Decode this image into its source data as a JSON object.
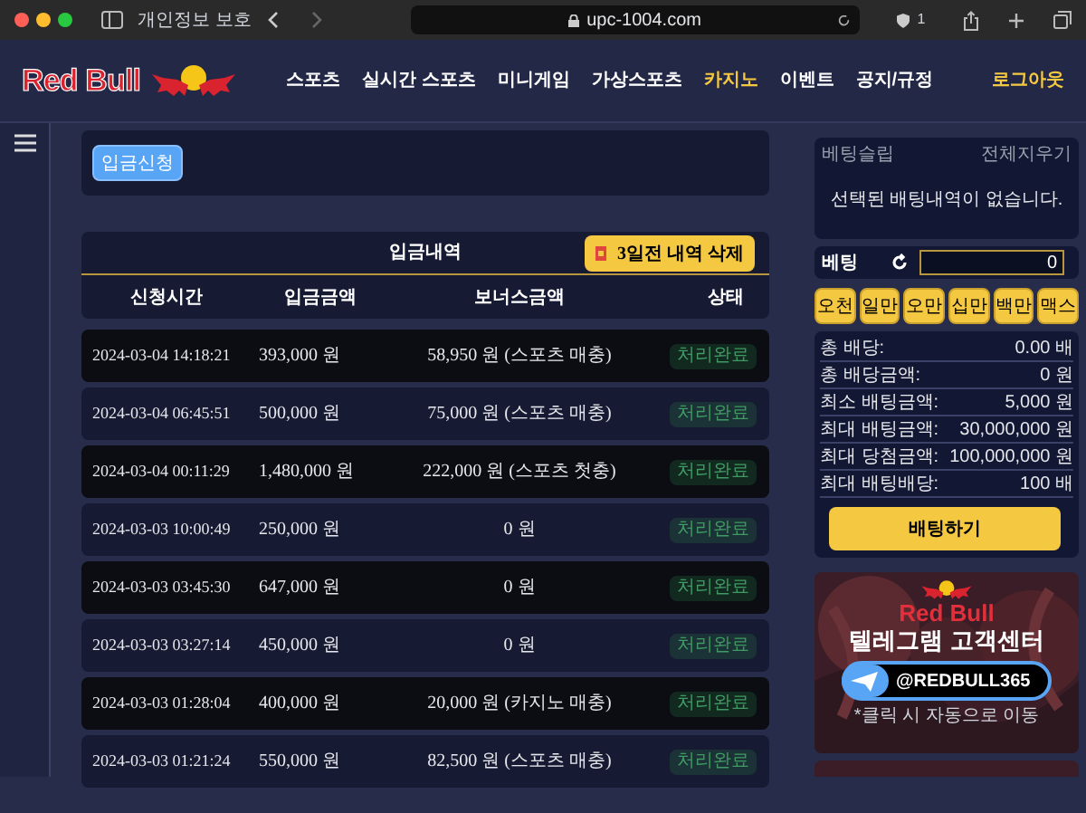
{
  "browser": {
    "tab_label": "개인정보 보호",
    "url": "upc-1004.com",
    "shield_count": "1"
  },
  "header": {
    "logo": "Red Bull",
    "nav": [
      {
        "label": "스포츠",
        "selected": false
      },
      {
        "label": "실시간 스포츠",
        "selected": false
      },
      {
        "label": "미니게임",
        "selected": false
      },
      {
        "label": "가상스포츠",
        "selected": false
      },
      {
        "label": "카지노",
        "selected": true
      },
      {
        "label": "이벤트",
        "selected": false
      },
      {
        "label": "공지/규정",
        "selected": false
      }
    ],
    "logout": "로그아웃"
  },
  "deposit": {
    "button": "입금신청"
  },
  "history": {
    "title": "입금내역",
    "delete_button": "3일전 내역 삭제",
    "columns": [
      "신청시간",
      "입금금액",
      "보너스금액",
      "상태"
    ],
    "rows": [
      {
        "time": "2024-03-04 14:18:21",
        "amount": "393,000 원",
        "bonus": "58,950 원 (스포츠 매충)",
        "status": "처리완료"
      },
      {
        "time": "2024-03-04 06:45:51",
        "amount": "500,000 원",
        "bonus": "75,000 원 (스포츠 매충)",
        "status": "처리완료"
      },
      {
        "time": "2024-03-04 00:11:29",
        "amount": "1,480,000 원",
        "bonus": "222,000 원 (스포츠 첫충)",
        "status": "처리완료"
      },
      {
        "time": "2024-03-03 10:00:49",
        "amount": "250,000 원",
        "bonus": "0 원",
        "status": "처리완료"
      },
      {
        "time": "2024-03-03 03:45:30",
        "amount": "647,000 원",
        "bonus": "0 원",
        "status": "처리완료"
      },
      {
        "time": "2024-03-03 03:27:14",
        "amount": "450,000 원",
        "bonus": "0 원",
        "status": "처리완료"
      },
      {
        "time": "2024-03-03 01:28:04",
        "amount": "400,000 원",
        "bonus": "20,000 원 (카지노 매충)",
        "status": "처리완료"
      },
      {
        "time": "2024-03-03 01:21:24",
        "amount": "550,000 원",
        "bonus": "82,500 원 (스포츠 매충)",
        "status": "처리완료"
      }
    ]
  },
  "bet_slip": {
    "title": "베팅슬립",
    "clear": "전체지우기",
    "empty": "선택된 배팅내역이 없습니다."
  },
  "bet": {
    "label": "베팅",
    "amount": "0",
    "quick": [
      "오천",
      "일만",
      "오만",
      "십만",
      "백만",
      "맥스"
    ]
  },
  "summary": [
    {
      "label": "총 배당:",
      "value": "0.00 배"
    },
    {
      "label": "총 배당금액:",
      "value": "0 원"
    },
    {
      "label": "최소 배팅금액:",
      "value": "5,000 원"
    },
    {
      "label": "최대 배팅금액:",
      "value": "30,000,000 원"
    },
    {
      "label": "최대 당첨금액:",
      "value": "100,000,000 원"
    },
    {
      "label": "최대 배팅배당:",
      "value": "100 배"
    }
  ],
  "bet_button": "배팅하기",
  "banner": {
    "brand": "Red Bull",
    "title": "텔레그램 고객센터",
    "handle": "@REDBULL365",
    "note": "*클릭 시 자동으로 이동"
  }
}
